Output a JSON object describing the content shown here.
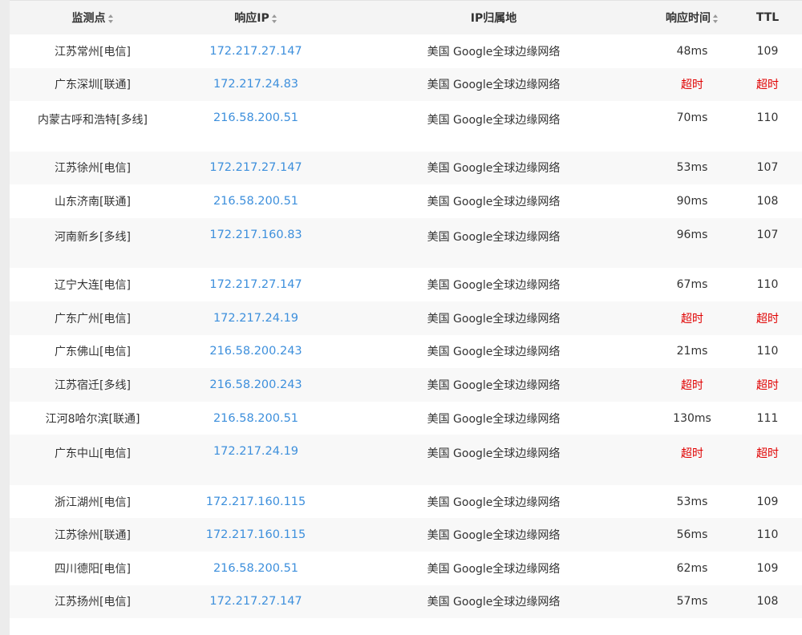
{
  "table": {
    "headers": [
      "监测点",
      "响应IP",
      "IP归属地",
      "响应时间",
      "TTL"
    ],
    "rows": [
      {
        "location": "江苏常州[电信]",
        "ip": "172.217.27.147",
        "owner": "美国 Google全球边缘网络",
        "time": "48ms",
        "ttl": "109"
      },
      {
        "location": "广东深圳[联通]",
        "ip": "172.217.24.83",
        "owner": "美国 Google全球边缘网络",
        "time": "超时",
        "ttl": "超时"
      },
      {
        "location": "内蒙古呼和浩特[多线]",
        "ip": "216.58.200.51",
        "owner": "美国 Google全球边缘网络",
        "time": "70ms",
        "ttl": "110"
      },
      {
        "location": "江苏徐州[电信]",
        "ip": "172.217.27.147",
        "owner": "美国 Google全球边缘网络",
        "time": "53ms",
        "ttl": "107"
      },
      {
        "location": "山东济南[联通]",
        "ip": "216.58.200.51",
        "owner": "美国 Google全球边缘网络",
        "time": "90ms",
        "ttl": "108"
      },
      {
        "location": "河南新乡[多线]",
        "ip": "172.217.160.83",
        "owner": "美国 Google全球边缘网络",
        "time": "96ms",
        "ttl": "107"
      },
      {
        "location": "辽宁大连[电信]",
        "ip": "172.217.27.147",
        "owner": "美国 Google全球边缘网络",
        "time": "67ms",
        "ttl": "110"
      },
      {
        "location": "广东广州[电信]",
        "ip": "172.217.24.19",
        "owner": "美国 Google全球边缘网络",
        "time": "超时",
        "ttl": "超时"
      },
      {
        "location": "广东佛山[电信]",
        "ip": "216.58.200.243",
        "owner": "美国 Google全球边缘网络",
        "time": "21ms",
        "ttl": "110"
      },
      {
        "location": "江苏宿迁[多线]",
        "ip": "216.58.200.243",
        "owner": "美国 Google全球边缘网络",
        "time": "超时",
        "ttl": "超时"
      },
      {
        "location": "江河8哈尔滨[联通]",
        "ip": "216.58.200.51",
        "owner": "美国 Google全球边缘网络",
        "time": "130ms",
        "ttl": "111"
      },
      {
        "location": "广东中山[电信]",
        "ip": "172.217.24.19",
        "owner": "美国 Google全球边缘网络",
        "time": "超时",
        "ttl": "超时"
      },
      {
        "location": "浙江湖州[电信]",
        "ip": "172.217.160.115",
        "owner": "美国 Google全球边缘网络",
        "time": "53ms",
        "ttl": "109"
      },
      {
        "location": "江苏徐州[联通]",
        "ip": "172.217.160.115",
        "owner": "美国 Google全球边缘网络",
        "time": "56ms",
        "ttl": "110"
      },
      {
        "location": "四川德阳[电信]",
        "ip": "216.58.200.51",
        "owner": "美国 Google全球边缘网络",
        "time": "62ms",
        "ttl": "109"
      },
      {
        "location": "江苏扬州[电信]",
        "ip": "172.217.27.147",
        "owner": "美国 Google全球边缘网络",
        "time": "57ms",
        "ttl": "108"
      }
    ]
  },
  "colors": {
    "link": "#3d8fdc",
    "timeout": "#e00000",
    "header_bg": "#f4f4f4",
    "stripe": "#f8f8f8"
  }
}
